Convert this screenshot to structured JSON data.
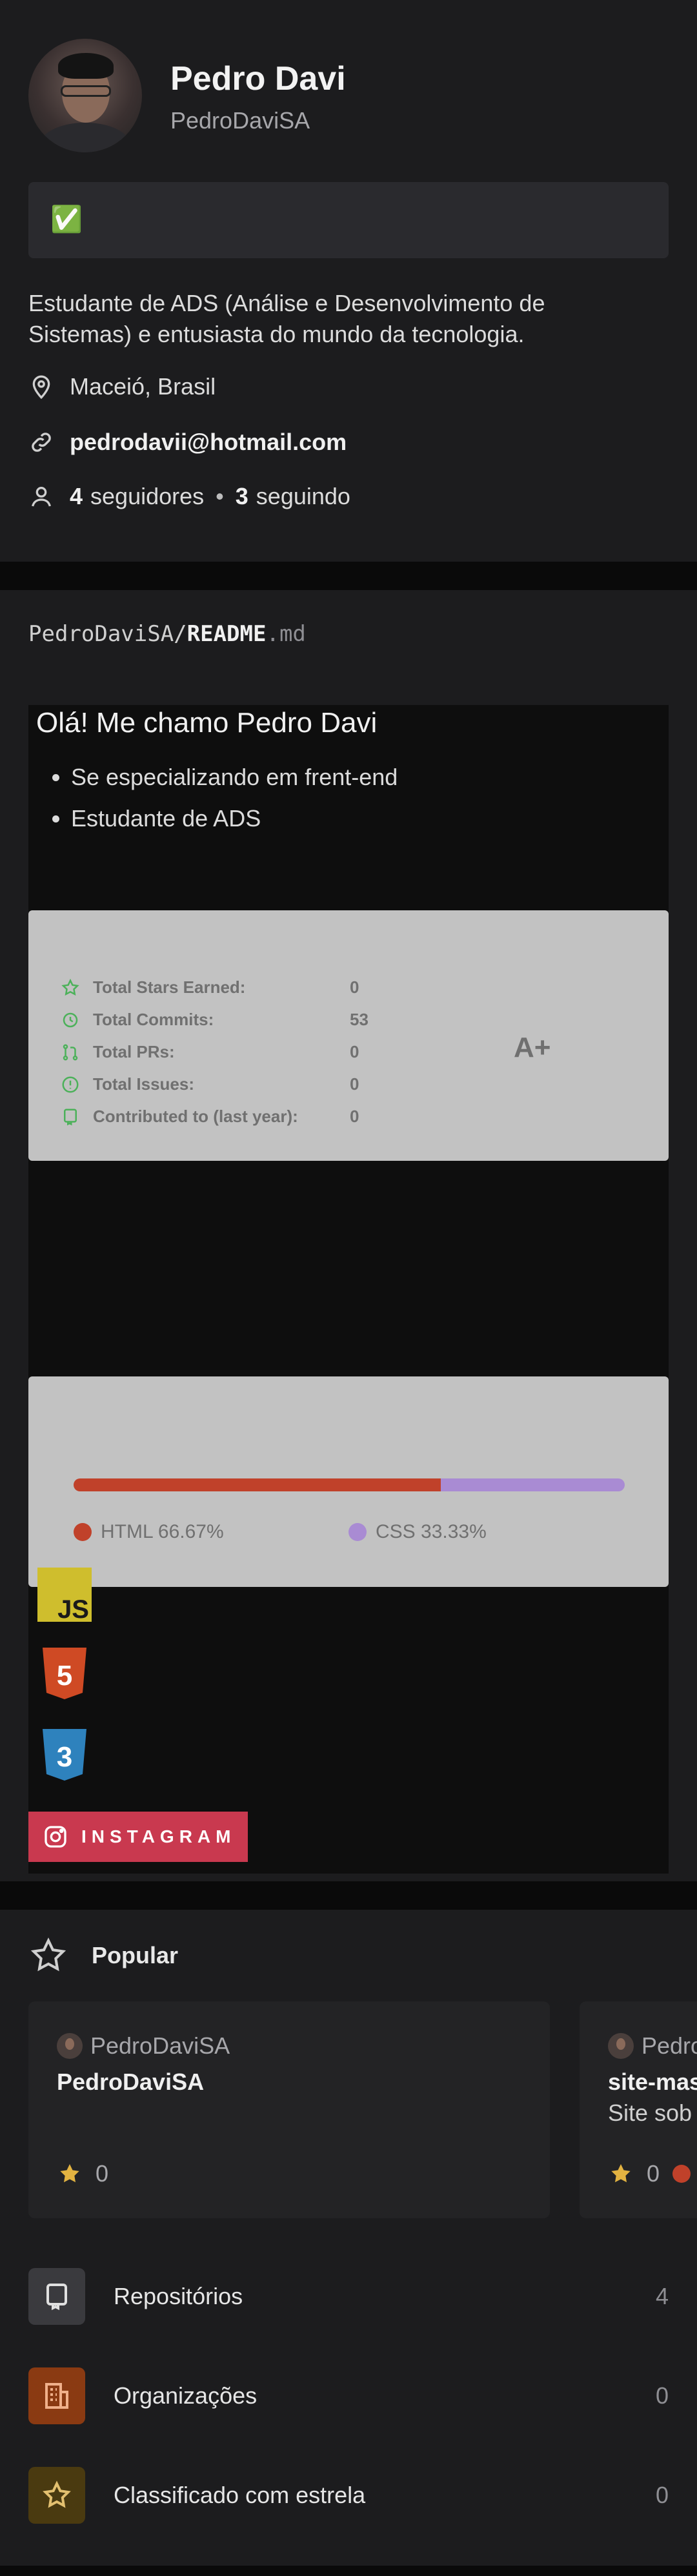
{
  "profile": {
    "name": "Pedro Davi",
    "login": "PedroDaviSA",
    "status_emoji": "✅",
    "bio": "Estudante de ADS (Análise e Desenvolvimento de Sistemas) e entusiasta do mundo da tecnologia.",
    "location": "Maceió, Brasil",
    "email": "pedrodavii@hotmail.com",
    "followers_count": "4",
    "followers_label": "seguidores",
    "following_count": "3",
    "following_label": "seguindo",
    "separator": "•"
  },
  "readme": {
    "owner": "PedroDaviSA/",
    "file": "README",
    "ext": ".md",
    "heading": "Olá! Me chamo Pedro Davi",
    "bullets": [
      "Se especializando em frent-end",
      "Estudante de ADS"
    ],
    "stats": {
      "rows": [
        {
          "label": "Total Stars Earned:",
          "value": "0",
          "icon": "star-icon"
        },
        {
          "label": "Total Commits:",
          "value": "53",
          "icon": "history-icon"
        },
        {
          "label": "Total PRs:",
          "value": "0",
          "icon": "pull-request-icon"
        },
        {
          "label": "Total Issues:",
          "value": "0",
          "icon": "issue-icon"
        },
        {
          "label": "Contributed to (last year):",
          "value": "0",
          "icon": "repo-icon"
        }
      ],
      "grade": "A+",
      "icon_color": "#4cb15a"
    },
    "languages": [
      {
        "name": "HTML 66.67%",
        "percent": 66.67,
        "color": "#c0412a"
      },
      {
        "name": "CSS 33.33%",
        "percent": 33.33,
        "color": "#a98bd3"
      }
    ],
    "badges": [
      {
        "icon": "javascript-icon",
        "text": "JS",
        "color": "#cfbe2d"
      },
      {
        "icon": "html5-icon",
        "text": "5",
        "color": "#cf4a24"
      },
      {
        "icon": "css3-icon",
        "text": "3",
        "color": "#2e82bd"
      }
    ],
    "instagram_label": "INSTAGRAM"
  },
  "popular": {
    "title": "Popular",
    "cards": [
      {
        "owner": "PedroDaviSA",
        "name": "PedroDaviSA",
        "description": "",
        "stars": "0"
      },
      {
        "owner": "PedroDaviSA",
        "name": "site-mas",
        "description": "Site sob",
        "stars": "0",
        "lang_color": "#c0412a"
      }
    ]
  },
  "lists": [
    {
      "label": "Repositórios",
      "count": "4",
      "icon": "repo-icon",
      "bg": "#3a3a3e"
    },
    {
      "label": "Organizações",
      "count": "0",
      "icon": "organization-icon",
      "bg": "#8a3a12"
    },
    {
      "label": "Classificado com estrela",
      "count": "0",
      "icon": "star-icon",
      "bg": "#4a3a10"
    }
  ]
}
